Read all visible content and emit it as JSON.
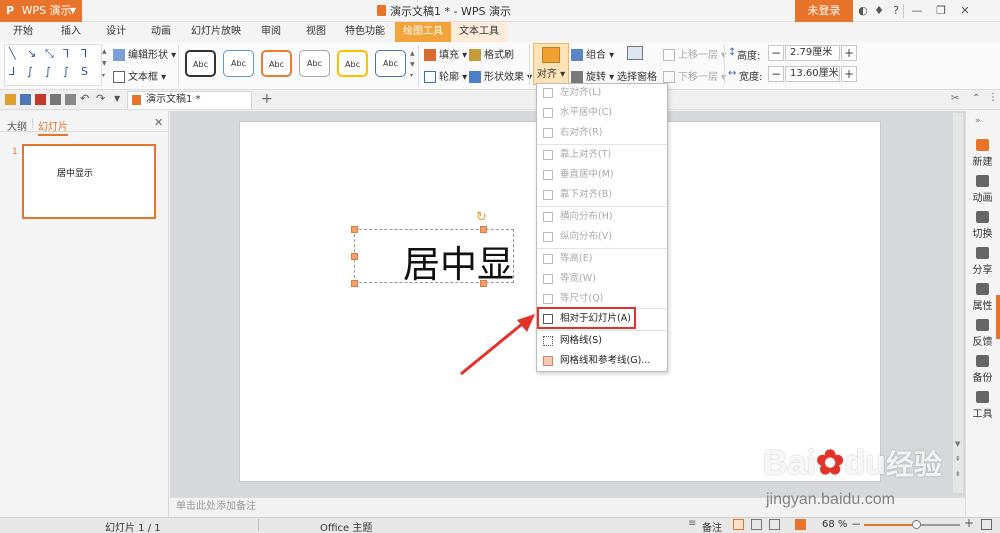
{
  "titlebar": {
    "app_name": "WPS 演示",
    "logo": "P",
    "document_title": "演示文稿1 * - WPS 演示",
    "login_label": "未登录"
  },
  "menu": {
    "tabs": [
      "开始",
      "插入",
      "设计",
      "动画",
      "幻灯片放映",
      "审阅",
      "视图",
      "特色功能",
      "绘图工具",
      "文本工具"
    ],
    "active": "绘图工具"
  },
  "ribbon": {
    "edit_shape": "编辑形状",
    "text_box": "文本框",
    "style_label": "Abc",
    "fill": "填充",
    "format_painter": "格式刷",
    "outline": "轮廓",
    "shape_effect": "形状效果",
    "align": "对齐",
    "group": "组合",
    "rotate": "旋转",
    "selection_pane": "选择窗格",
    "bring_forward": "上移一层",
    "send_backward": "下移一层",
    "height_label": "高度:",
    "height_value": "2.79厘米",
    "width_label": "宽度:",
    "width_value": "13.60厘米",
    "plus": "+",
    "minus": "−"
  },
  "quickbar": {
    "doc_tab": "演示文稿1 *",
    "new_tab": "+"
  },
  "left_panel": {
    "tab_outline": "大纲",
    "tab_slides": "幻灯片",
    "slide_number": "1",
    "thumb_text": "居中显示"
  },
  "slide": {
    "text": "居中显示"
  },
  "align_menu": {
    "items": [
      {
        "label": "左对齐(L)"
      },
      {
        "label": "水平居中(C)"
      },
      {
        "label": "右对齐(R)"
      },
      {
        "label": "靠上对齐(T)"
      },
      {
        "label": "垂直居中(M)"
      },
      {
        "label": "靠下对齐(B)"
      },
      {
        "label": "横向分布(H)"
      },
      {
        "label": "纵向分布(V)"
      },
      {
        "label": "等高(E)"
      },
      {
        "label": "等宽(W)"
      },
      {
        "label": "等尺寸(Q)"
      },
      {
        "label": "相对于幻灯片(A)"
      },
      {
        "label": "网格线(S)"
      },
      {
        "label": "网格线和参考线(G)..."
      }
    ]
  },
  "right_bar": {
    "items": [
      "新建",
      "动画",
      "切换",
      "分享",
      "属性",
      "反馈",
      "备份",
      "工具"
    ]
  },
  "notes_placeholder": "单击此处添加备注",
  "status": {
    "slide_counter": "幻灯片 1 / 1",
    "theme": "Office 主题",
    "notes": "备注",
    "zoom": "68 %",
    "zoom_minus": "−",
    "zoom_plus": "+",
    "zoom_level": 0.55
  },
  "watermark": {
    "brand": "Bai",
    "brand2": "du",
    "brand_cn": "经验",
    "url": "jingyan.baidu.com"
  },
  "colors": {
    "accent": "#e8742b",
    "active_tab": "#f2a33a",
    "highlight": "#e4322b"
  }
}
